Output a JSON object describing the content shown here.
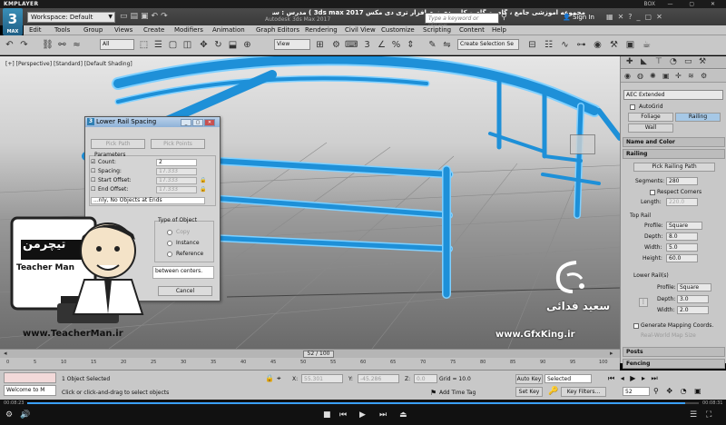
{
  "player": {
    "brand": "KMPLAYER",
    "box_label": "BOX",
    "window_controls": "— ▢ ✕",
    "elapsed": "00:08:23",
    "total": "00:08:31",
    "progress": 0.98
  },
  "title_bar": {
    "logo_label": "3",
    "logo_sub": "MAX",
    "workspace": "Workspace: Default",
    "course_title": "مجموعه آموزشی جامع ، گام به گام و کاربردی نرم افزار تری دی مکس  3ds max 2017 )  مدرس : سعید فدایی ( تیچرمن ) گروه آموزشی پادشاه گرافیست ها",
    "app_title": "Autodesk 3ds Max 2017",
    "search_placeholder": "Type a keyword or phrase",
    "sign_in": "Sign In"
  },
  "menu": [
    "Edit",
    "Tools",
    "Group",
    "Views",
    "Create",
    "Modifiers",
    "Animation",
    "Graph Editors",
    "Rendering",
    "Civil View",
    "Customize",
    "Scripting",
    "Content",
    "Help"
  ],
  "toolbar": {
    "selection_filter": "All",
    "ref_coord": "View",
    "create_selection_set": "Create Selection Se"
  },
  "viewport": {
    "label": "[+] [Perspective] [Standard] [Default Shading]"
  },
  "command_panel": {
    "category": "AEC Extended",
    "autogrid": "AutoGrid",
    "object_types": [
      "Foliage",
      "Railing",
      "Wall"
    ],
    "active_type": "Railing",
    "rollouts": {
      "name_color": "Name and Color",
      "railing": "Railing",
      "posts": "Posts",
      "fencing": "Fencing"
    },
    "pick_path": "Pick Railing Path",
    "segments_label": "Segments:",
    "segments": "280",
    "respect_corners": "Respect Corners",
    "length_label": "Length:",
    "length": "220.0",
    "top_rail": {
      "heading": "Top Rail",
      "profile_label": "Profile:",
      "profile": "Square",
      "depth_label": "Depth:",
      "depth": "8.0",
      "width_label": "Width:",
      "width": "5.0",
      "height_label": "Height:",
      "height": "60.0"
    },
    "lower_rails": {
      "heading": "Lower Rail(s)",
      "profile_label": "Profile:",
      "profile": "Square",
      "depth_label": "Depth:",
      "depth": "3.0",
      "width_label": "Width:",
      "width": "2.0"
    },
    "gen_mapping": "Generate Mapping Coords.",
    "real_world": "Real-World Map Size"
  },
  "dialog": {
    "title": "Lower Rail Spacing",
    "pick_path": "Pick Path",
    "pick_points": "Pick Points",
    "params_heading": "Parameters",
    "count_label": "Count:",
    "count": "2",
    "spacing_label": "Spacing:",
    "spacing": "17.333",
    "start_offset_label": "Start Offset:",
    "start_offset": "17.333",
    "end_offset_label": "End Offset:",
    "end_offset": "17.333",
    "align_option": "...nly, No Objects at Ends",
    "object_type_heading": "Type of Object",
    "copy": "Copy",
    "instance": "Instance",
    "reference": "Reference",
    "info_text": "between centers.",
    "cancel": "Cancel"
  },
  "watermarks": {
    "teacher_logo": "تیچرمن",
    "teacher_name": "Teacher Man",
    "teacher_url": "www.TeacherMan.ir",
    "gfx_name": "سعید فدائی",
    "gfx_url": "www.GfxKing.ir"
  },
  "timeline": {
    "frame_display": "52 / 100",
    "ticks": [
      "0",
      "5",
      "10",
      "15",
      "20",
      "25",
      "30",
      "35",
      "40",
      "45",
      "50",
      "55",
      "60",
      "65",
      "70",
      "75",
      "80",
      "85",
      "90",
      "95",
      "100"
    ]
  },
  "status": {
    "welcome": "Welcome to M",
    "selected": "1 Object Selected",
    "prompt": "Click or click-and-drag to select objects",
    "x_label": "X:",
    "x_value": "55.301",
    "y_label": "Y:",
    "y_value": "-45.286",
    "z_label": "Z:",
    "z_value": "0.0",
    "grid": "Grid = 10.0",
    "add_time_tag": "Add Time Tag",
    "auto_key": "Auto Key",
    "selected_dd": "Selected",
    "set_key": "Set Key",
    "key_filters": "Key Filters...",
    "frame": "52"
  },
  "colors": {
    "rail": "#1e90d8",
    "rail_edge": "#7fd0ff",
    "selection_tab": "#a6c8e6"
  }
}
